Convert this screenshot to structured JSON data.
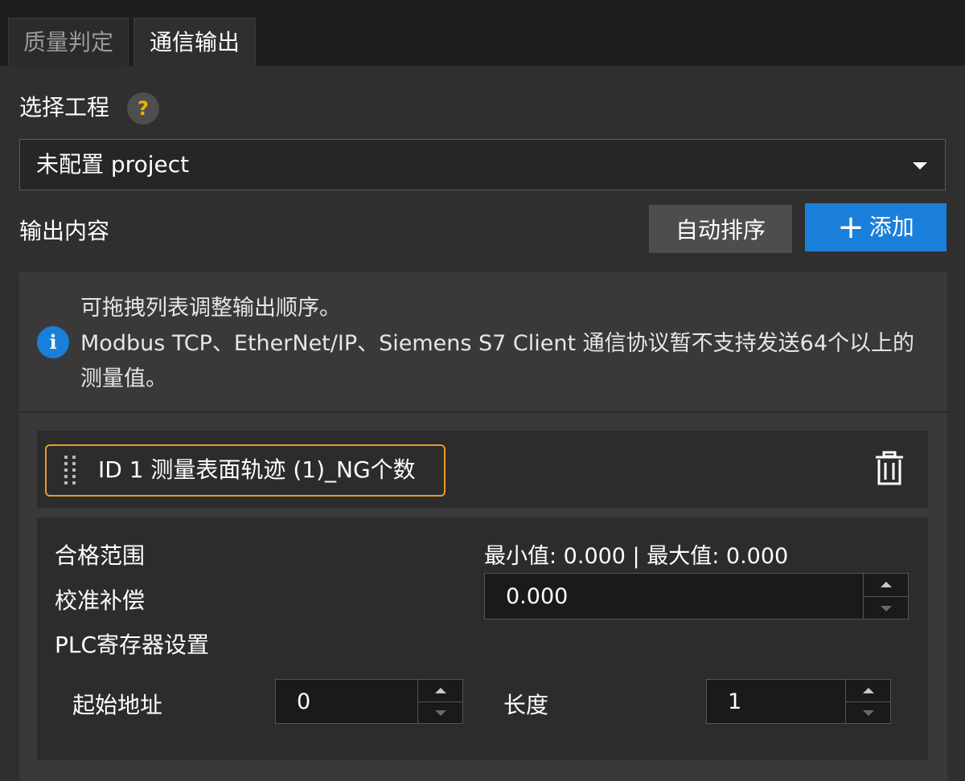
{
  "tabs": [
    {
      "label": "质量判定",
      "active": false
    },
    {
      "label": "通信输出",
      "active": true
    }
  ],
  "project": {
    "label": "选择工程",
    "help_icon": "?",
    "selected": "未配置 project"
  },
  "output": {
    "label": "输出内容",
    "sort_button": "自动排序",
    "add_button": "添加",
    "add_icon": "+"
  },
  "info": {
    "icon": "i",
    "line1": "可拖拽列表调整输出顺序。",
    "line2": "Modbus TCP、EtherNet/IP、Siemens S7 Client 通信协议暂不支持发送64个以上的测量值。"
  },
  "item": {
    "title": "ID 1  测量表面轨迹 (1)_NG个数",
    "pass_range_label": "合格范围",
    "pass_range_value": "最小值: 0.000 | 最大值: 0.000",
    "calibration_label": "校准补偿",
    "calibration_value": "0.000",
    "plc_label": "PLC寄存器设置",
    "start_address_label": "起始地址",
    "start_address_value": "0",
    "length_label": "长度",
    "length_value": "1"
  },
  "colors": {
    "accent": "#1a7fd9",
    "highlight": "#e99a2c",
    "help": "#f0b000"
  }
}
